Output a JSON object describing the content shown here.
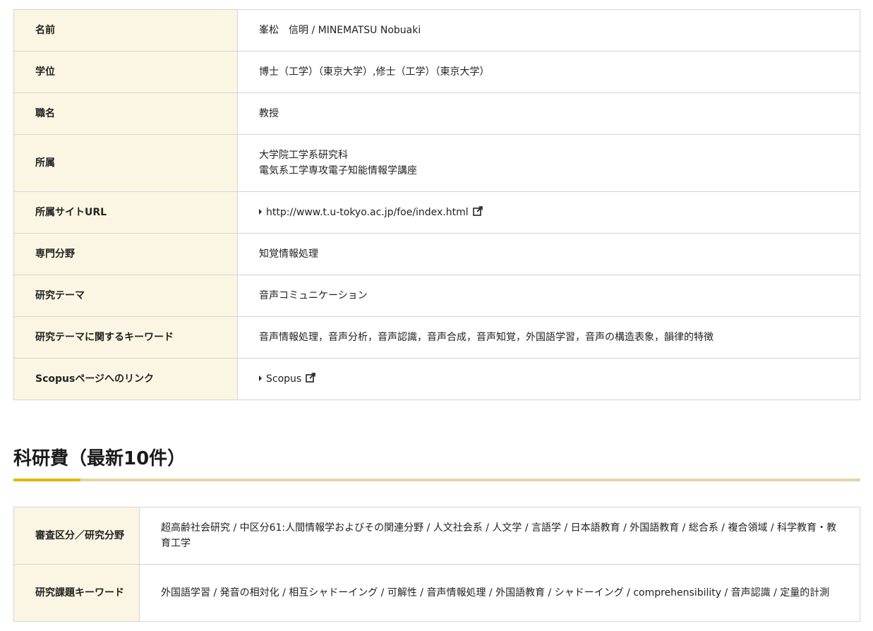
{
  "profile": {
    "rows": [
      {
        "label": "名前",
        "value": "峯松　信明 / MINEMATSU Nobuaki"
      },
      {
        "label": "学位",
        "value": "博士（工学）（東京大学）,修士（工学）（東京大学）"
      },
      {
        "label": "職名",
        "value": "教授"
      },
      {
        "label": "所属",
        "lines": [
          "大学院工学系研究科",
          "電気系工学専攻電子知能情報学講座"
        ]
      },
      {
        "label": "所属サイトURL",
        "link": "http://www.t.u-tokyo.ac.jp/foe/index.html",
        "icon": "external-link-icon"
      },
      {
        "label": "専門分野",
        "value": "知覚情報処理"
      },
      {
        "label": "研究テーマ",
        "value": "音声コミュニケーション"
      },
      {
        "label": "研究テーマに関するキーワード",
        "value": "音声情報処理，音声分析，音声認識，音声合成，音声知覚，外国語学習，音声の構造表象，韻律的特徴"
      },
      {
        "label": "Scopusページへのリンク",
        "link": "Scopus",
        "icon": "external-link-icon"
      }
    ]
  },
  "kaken": {
    "heading": "科研費（最新10件）",
    "rows": [
      {
        "label": "審査区分／研究分野",
        "value": "超高齢社会研究 / 中区分61:人間情報学およびその関連分野 / 人文社会系 / 人文学 / 言語学 / 日本語教育 / 外国語教育 / 総合系 / 複合領域 / 科学教育・教育工学"
      },
      {
        "label": "研究課題キーワード",
        "value": "外国語学習 / 発音の相対化 / 相互シャドーイング / 可解性 / 音声情報処理 / 外国語教育 / シャドーイング / comprehensibility / 音声認識 / 定量的計測"
      }
    ]
  },
  "colors": {
    "header_bg": "#fbf6e3",
    "border": "#d4d4d4",
    "accent": "#e8b500",
    "rule": "#e3d5a4"
  }
}
